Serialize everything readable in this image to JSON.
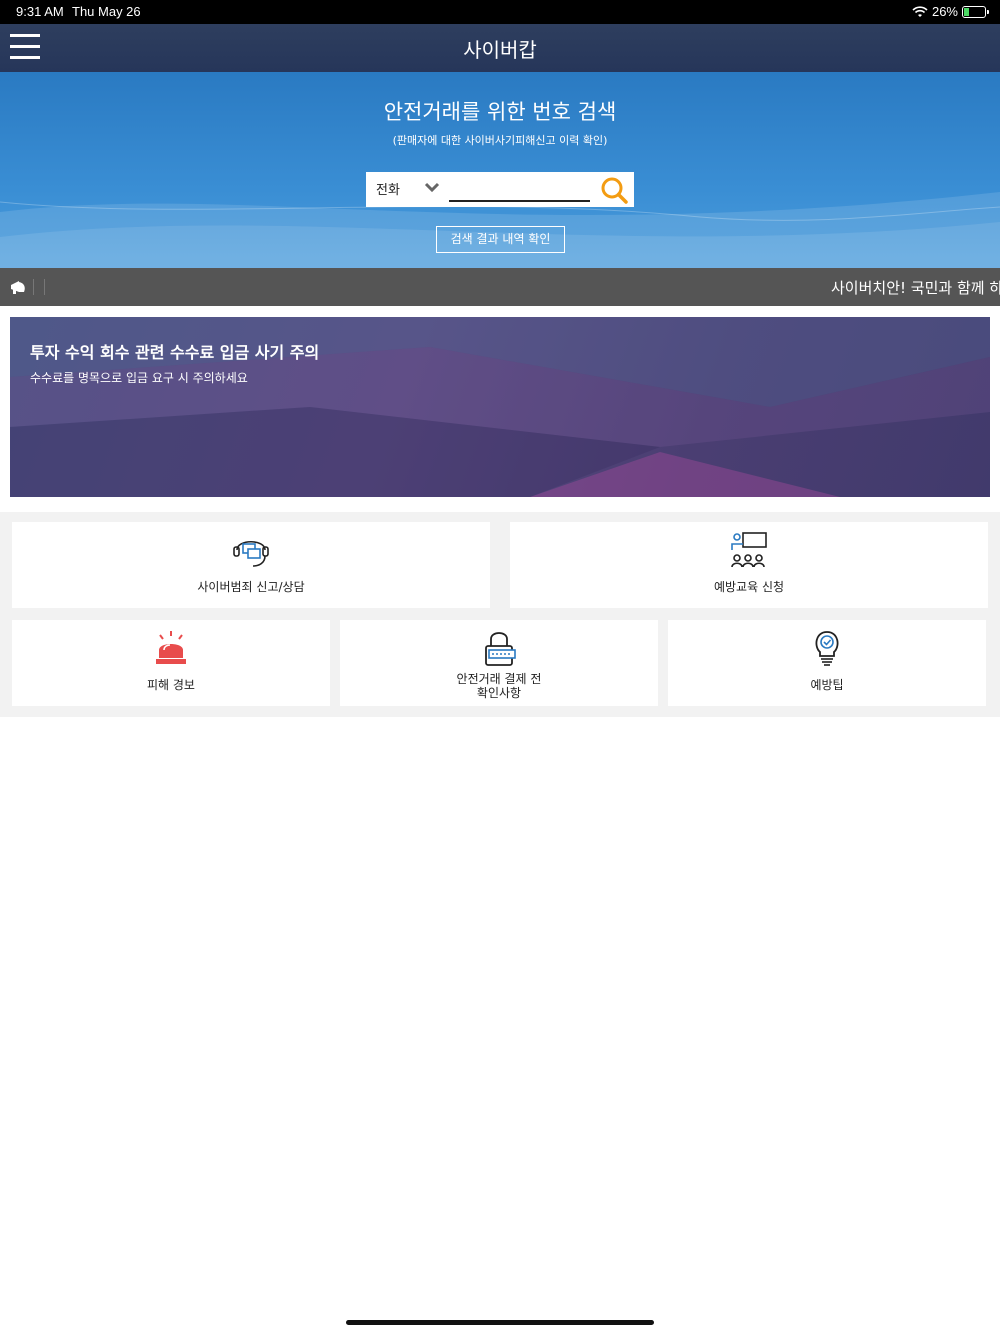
{
  "status_bar": {
    "time": "9:31 AM",
    "date": "Thu May 26",
    "battery": "26%",
    "battery_level": 0.26
  },
  "navbar": {
    "title": "사이버캅"
  },
  "hero": {
    "title": "안전거래를 위한 번호 검색",
    "subtitle": "(판매자에 대한 사이버사기피해신고 이력 확인)",
    "search_type": "전화",
    "search_value": "",
    "history_button": "검색 결과 내역 확인"
  },
  "ticker": {
    "text": "사이버치안! 국민과 함께 하겠습니다"
  },
  "banner": {
    "title": "투자 수익 회수 관련 수수료 입금 사기 주의",
    "subtitle": "수수료를 명목으로 입금 요구 시 주의하세요"
  },
  "menu": {
    "report": "사이버범죄 신고/상담",
    "education": "예방교육 신청",
    "alert": "피해 경보",
    "check_line1": "안전거래 결제 전",
    "check_line2": "확인사항",
    "tips": "예방팁"
  },
  "colors": {
    "accent": "#f39c12",
    "alert": "#e84c4c",
    "icon_blue": "#2a7ac2",
    "navbar": "#2e3e5e"
  }
}
